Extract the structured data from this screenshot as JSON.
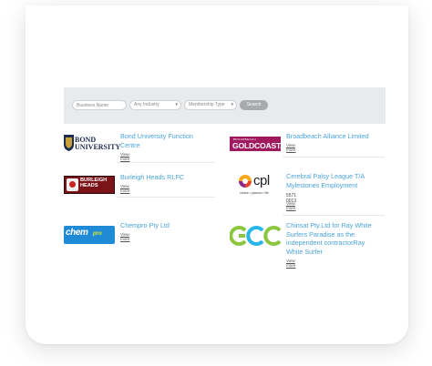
{
  "search": {
    "business_placeholder": "Business Name",
    "industry_selected": "Any Industry",
    "membership_selected": "Membership Type",
    "button_label": "Search"
  },
  "listings": [
    {
      "name_lines": [
        "Bond University Function",
        "Centre"
      ],
      "view_label": "View more",
      "logo_icon": "bond-university-logo",
      "logo_text": [
        "BOND",
        "UNIVERSITY"
      ]
    },
    {
      "name_lines": [
        "Broadbeach Alliance Limited"
      ],
      "view_label": "View more",
      "logo_icon": "goldcoast-logo",
      "logo_text": [
        "BROADBEACH",
        "GOLDCOAST."
      ]
    },
    {
      "name_lines": [
        "Burleigh Heads RLFC"
      ],
      "view_label": "View more",
      "logo_icon": "burleigh-heads-logo",
      "logo_text": [
        "BURLEIGH",
        "HEADS"
      ]
    },
    {
      "name_lines": [
        "Cerebral Palsy League T/A",
        "Mylestones Employment"
      ],
      "phone": "5571 0013",
      "view_label": "View more",
      "logo_icon": "cpl-logo",
      "logo_text": [
        "cpl",
        "choice • passion • life"
      ]
    },
    {
      "name_lines": [
        "Chempro Pty Ltd"
      ],
      "view_label": "View more",
      "logo_icon": "chempro-logo",
      "logo_text": [
        "chem",
        "pro"
      ]
    },
    {
      "name_lines": [
        "Chinsat Pty.Ltd for Ray White",
        "Surfers Paradise as the",
        "independent contractorRay",
        "White Surfer"
      ],
      "view_label": "View more",
      "logo_icon": "gcc-logo",
      "logo_text": []
    }
  ],
  "colors": {
    "link": "#4ba3d9",
    "search_bar_bg": "#e9eaeb",
    "goldcoast": "#a0185d",
    "chempro": "#1f8ad6",
    "gcc_green": "#8cc63f",
    "gcc_blue": "#29b6e8"
  }
}
